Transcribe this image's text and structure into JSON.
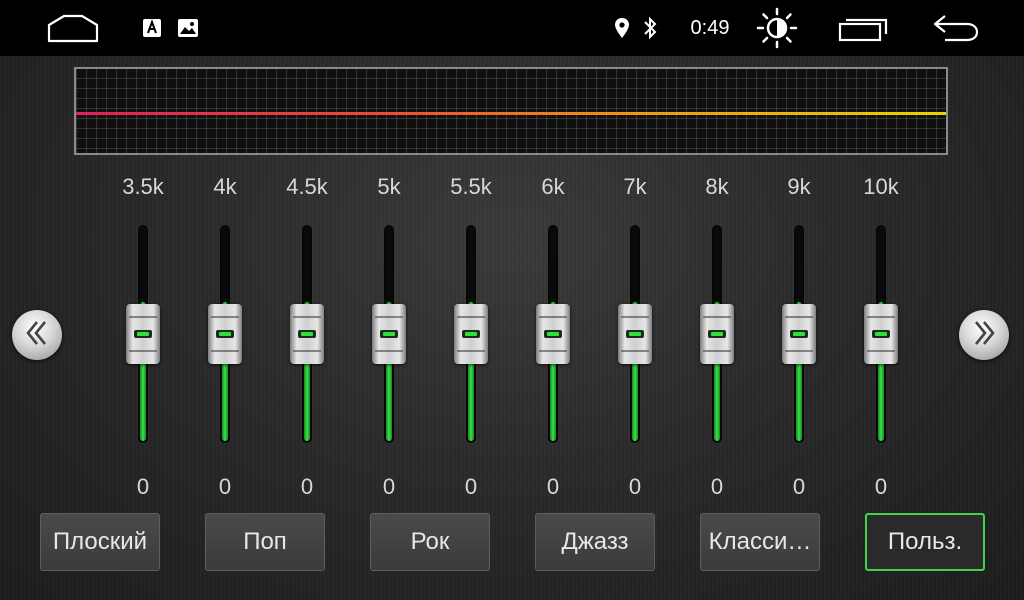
{
  "status_bar": {
    "time": "0:49",
    "icons": [
      "home-icon",
      "app-a-icon",
      "gallery-icon",
      "location-icon",
      "bluetooth-icon",
      "brightness-icon",
      "recent-apps-icon",
      "back-icon"
    ]
  },
  "equalizer": {
    "curve_color_start": "#e0205a",
    "curve_color_end": "#e8d400",
    "accent_color": "#37e24a",
    "bands": [
      {
        "freq": "3.5k",
        "value": "0",
        "level": 0.5
      },
      {
        "freq": "4k",
        "value": "0",
        "level": 0.5
      },
      {
        "freq": "4.5k",
        "value": "0",
        "level": 0.5
      },
      {
        "freq": "5k",
        "value": "0",
        "level": 0.5
      },
      {
        "freq": "5.5k",
        "value": "0",
        "level": 0.5
      },
      {
        "freq": "6k",
        "value": "0",
        "level": 0.5
      },
      {
        "freq": "7k",
        "value": "0",
        "level": 0.5
      },
      {
        "freq": "8k",
        "value": "0",
        "level": 0.5
      },
      {
        "freq": "9k",
        "value": "0",
        "level": 0.5
      },
      {
        "freq": "10k",
        "value": "0",
        "level": 0.5
      }
    ]
  },
  "nav": {
    "prev_icon": "double-chevron-left-icon",
    "next_icon": "double-chevron-right-icon"
  },
  "presets": [
    {
      "label": "Плоский",
      "active": false
    },
    {
      "label": "Поп",
      "active": false
    },
    {
      "label": "Рок",
      "active": false
    },
    {
      "label": "Джазз",
      "active": false
    },
    {
      "label": "Класси…",
      "active": false
    },
    {
      "label": "Польз.",
      "active": true
    }
  ]
}
